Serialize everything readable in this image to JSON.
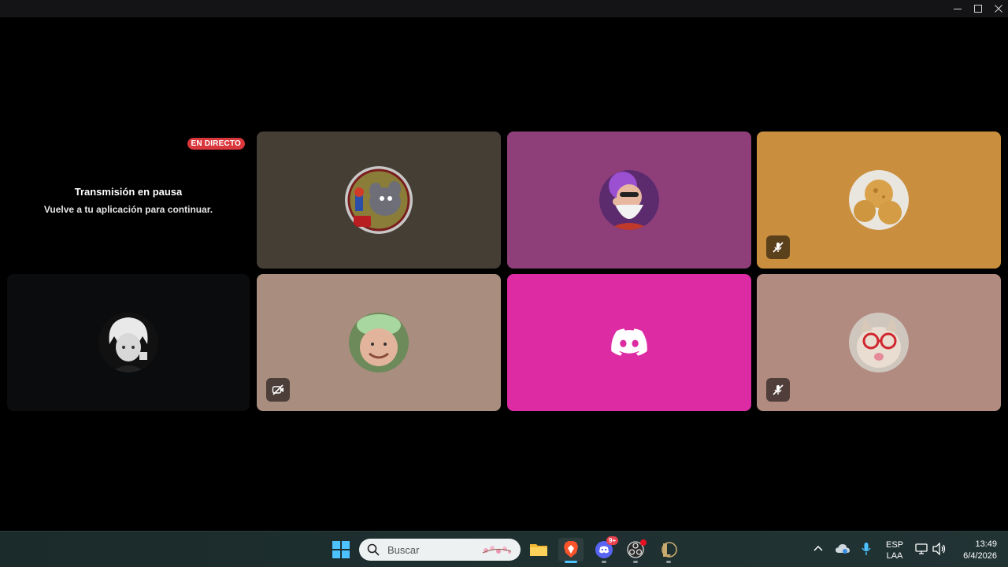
{
  "window": {
    "controls": [
      "minimize-icon",
      "maximize-icon",
      "close-icon"
    ]
  },
  "stream": {
    "live_badge": "EN DIRECTO",
    "paused_title": "Transmisión en pausa",
    "paused_subtitle": "Vuelve a tu aplicación para continuar."
  },
  "tiles": [
    {
      "id": "tile-1",
      "color": "#453e34",
      "avatar": "tom-cat-mario-avatar",
      "status": null
    },
    {
      "id": "tile-2",
      "color": "#8e3f79",
      "avatar": "master-roshi-avatar",
      "status": null
    },
    {
      "id": "tile-3",
      "color": "#c98f3f",
      "avatar": "bread-rolls-avatar",
      "status": "mic-muted-icon"
    },
    {
      "id": "tile-4",
      "color": "#0b0c0e",
      "avatar": "anime-white-hair-avatar",
      "status": null
    },
    {
      "id": "tile-5",
      "color": "#a98d7e",
      "avatar": "person-green-cap-avatar",
      "status": "camera-off-icon"
    },
    {
      "id": "tile-6",
      "color": "#dd2ba3",
      "avatar": "discord-logo-icon",
      "status": null
    },
    {
      "id": "tile-7",
      "color": "#b18a80",
      "avatar": "cat-red-glasses-avatar",
      "status": "mic-muted-icon"
    }
  ],
  "taskbar": {
    "search_placeholder": "Buscar",
    "apps": [
      "windows-start-icon",
      "file-explorer-icon",
      "brave-browser-icon",
      "discord-icon",
      "obs-icon",
      "league-of-legends-icon"
    ],
    "discord_badge": "9+",
    "language_top": "ESP",
    "language_bottom": "LAA",
    "time": "13:49",
    "date": "6/4/2026"
  }
}
